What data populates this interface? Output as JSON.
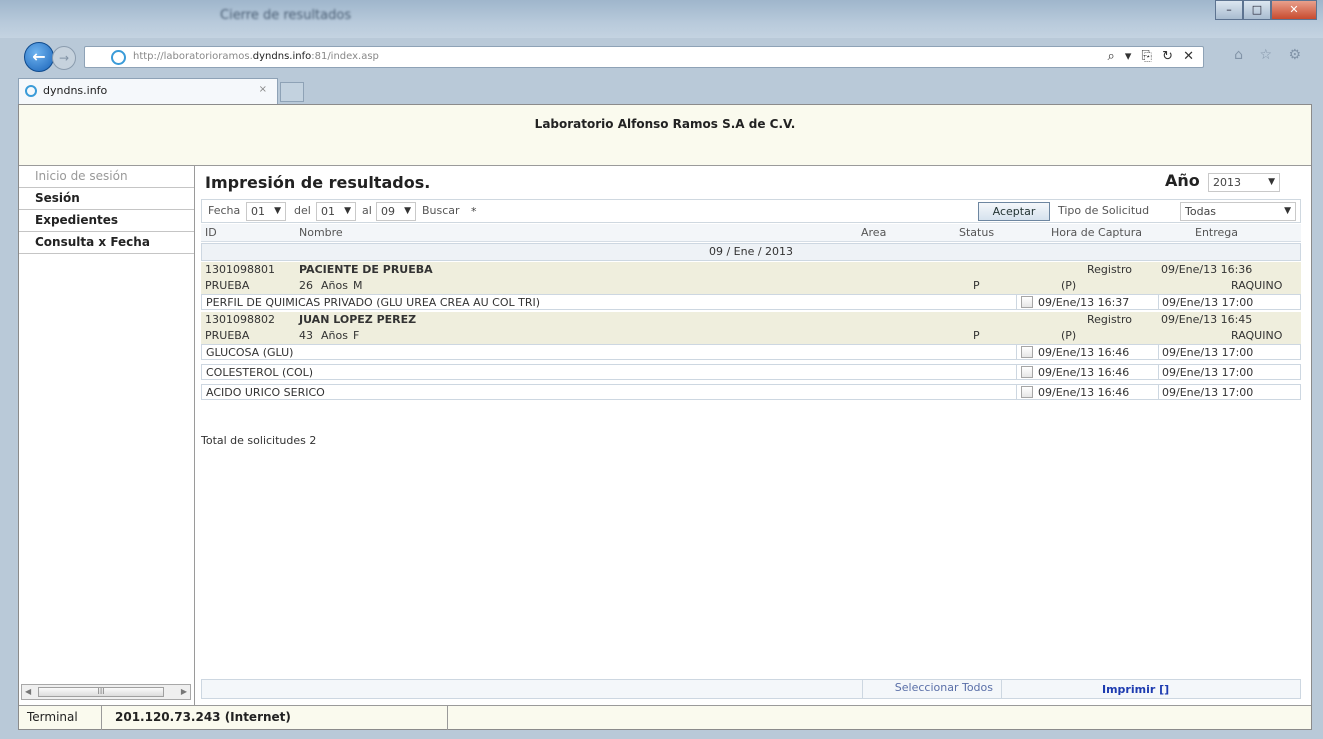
{
  "browser": {
    "window_title": "Cierre de resultados",
    "url_prefix": "http://laboratorioramos.",
    "url_domain": "dyndns.info",
    "url_suffix": ":81/index.asp",
    "tab_label": "dyndns.info",
    "tab_close": "×"
  },
  "page": {
    "header_title": "Laboratorio Alfonso Ramos S.A de C.V."
  },
  "menu": {
    "items": [
      {
        "label": "Inicio de sesión"
      },
      {
        "label": "Sesión"
      },
      {
        "label": "Expedientes"
      },
      {
        "label": "Consulta x Fecha"
      }
    ],
    "scroll_label": "III"
  },
  "main": {
    "title": "Impresión de resultados.",
    "year_label": "Año",
    "year_value": "2013",
    "filter": {
      "fecha_label": "Fecha",
      "month_value": "01",
      "del_label": "del",
      "del_value": "01",
      "al_label": "al",
      "al_value": "09",
      "buscar_label": "Buscar",
      "buscar_value": "*",
      "aceptar_label": "Aceptar",
      "tipo_label": "Tipo de Solicitud",
      "tipo_value": "Todas"
    },
    "columns": {
      "id": "ID",
      "nombre": "Nombre",
      "area": "Area",
      "status": "Status",
      "hora": "Hora de Captura",
      "entrega": "Entrega"
    },
    "date_group": "09 / Ene / 2013",
    "patients": [
      {
        "id": "1301098801",
        "name": "PACIENTE DE PRUEBA",
        "registro": "Registro",
        "registro_time": "09/Ene/13 16:36",
        "type": "PRUEBA",
        "age": "26",
        "age_unit": "Años",
        "sex": "M",
        "status": "P",
        "pflag": "(P)",
        "user": "RAQUINO",
        "studies": [
          {
            "name": "PERFIL DE QUIMICAS PRIVADO (GLU UREA CREA AU COL TRI)",
            "captura": "09/Ene/13 16:37",
            "entrega": "09/Ene/13 17:00"
          }
        ]
      },
      {
        "id": "1301098802",
        "name": "JUAN LOPEZ PEREZ",
        "registro": "Registro",
        "registro_time": "09/Ene/13 16:45",
        "type": "PRUEBA",
        "age": "43",
        "age_unit": "Años",
        "sex": "F",
        "status": "P",
        "pflag": "(P)",
        "user": "RAQUINO",
        "studies": [
          {
            "name": "GLUCOSA (GLU)",
            "captura": "09/Ene/13 16:46",
            "entrega": "09/Ene/13 17:00"
          },
          {
            "name": "COLESTEROL (COL)",
            "captura": "09/Ene/13 16:46",
            "entrega": "09/Ene/13 17:00"
          },
          {
            "name": "ACIDO URICO SERICO",
            "captura": "09/Ene/13 16:46",
            "entrega": "09/Ene/13 17:00"
          }
        ]
      }
    ],
    "total_label": "Total de solicitudes 2",
    "select_all_label": "Seleccionar Todos",
    "print_label": "Imprimir []"
  },
  "status": {
    "terminal_label": "Terminal",
    "ip": "201.120.73.243 (Internet)"
  }
}
